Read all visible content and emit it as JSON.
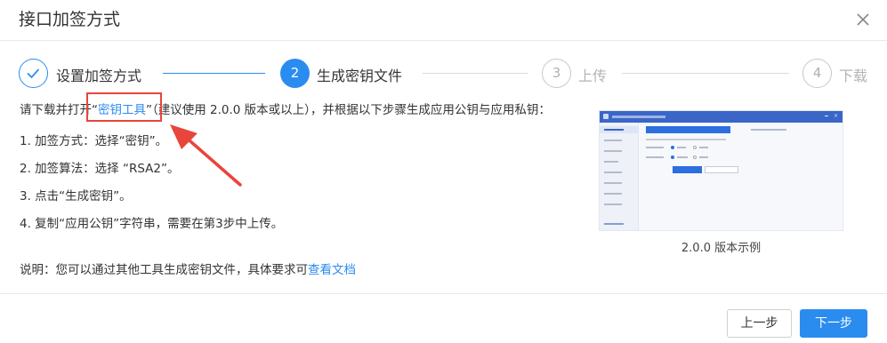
{
  "dialog": {
    "title": "接口加签方式"
  },
  "steps": [
    {
      "number": "1",
      "label": "设置加签方式",
      "state": "done"
    },
    {
      "number": "2",
      "label": "生成密钥文件",
      "state": "active"
    },
    {
      "number": "3",
      "label": "上传",
      "state": "wait"
    },
    {
      "number": "4",
      "label": "下载",
      "state": "wait"
    }
  ],
  "instructions": {
    "intro_prefix": "请下载并打开“",
    "tool_link": "密钥工具",
    "intro_suffix": "”（建议使用 2.0.0 版本或以上），并根据以下步骤生成应用公钥与应用私钥：",
    "items": [
      "1. 加签方式：选择“密钥”。",
      "2. 加签算法：选择 “RSA2”。",
      "3. 点击“生成密钥”。",
      "4. 复制“应用公钥”字符串，需要在第3步中上传。"
    ],
    "note_prefix": "说明：您可以通过其他工具生成密钥文件，具体要求可",
    "note_link": "查看文档"
  },
  "preview": {
    "caption": "2.0.0 版本示例"
  },
  "footer": {
    "prev_label": "上一步",
    "next_label": "下一步"
  },
  "colors": {
    "primary": "#2b8cf0",
    "annotation": "#e8453c"
  }
}
